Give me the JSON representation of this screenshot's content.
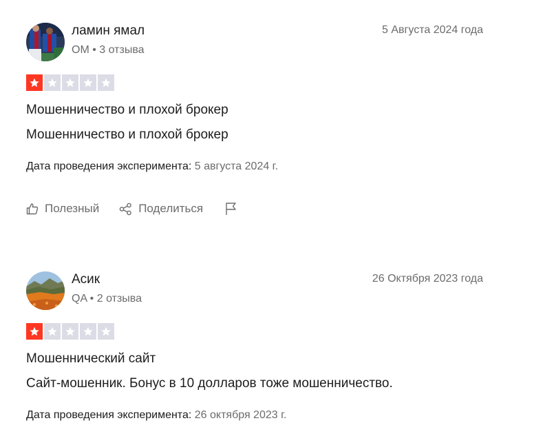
{
  "reviews": [
    {
      "author": "ламин ямал",
      "meta_country": "OM",
      "meta_sep": " • ",
      "meta_count": "3 отзыва",
      "date": "5 Августа 2024 года",
      "rating": 1,
      "rating_max": 5,
      "title": "Мошенничество и плохой брокер",
      "text": "Мошенничество и плохой брокер",
      "experience_label": "Дата проведения эксперимента:",
      "experience_value": "5 августа 2024 г.",
      "avatar_icon": "football-players-photo"
    },
    {
      "author": "Асик",
      "meta_country": "QA",
      "meta_sep": " • ",
      "meta_count": "2 отзыва",
      "date": "26 Октября 2023 года",
      "rating": 1,
      "rating_max": 5,
      "title": "Мошеннический сайт",
      "text": "Сайт-мошенник. Бонус в 10 долларов тоже мошенничество.",
      "experience_label": "Дата проведения эксперимента:",
      "experience_value": "26 октября 2023 г.",
      "avatar_icon": "landscape-poppy-field-photo"
    }
  ],
  "actions": {
    "useful_label": "Полезный",
    "share_label": "Поделиться",
    "useful_icon": "thumbs-up-icon",
    "share_icon": "share-icon",
    "flag_icon": "flag-icon"
  },
  "colors": {
    "star_on": "#ff3722",
    "star_off": "#dcdce6",
    "muted_text": "#6b6b6b"
  }
}
